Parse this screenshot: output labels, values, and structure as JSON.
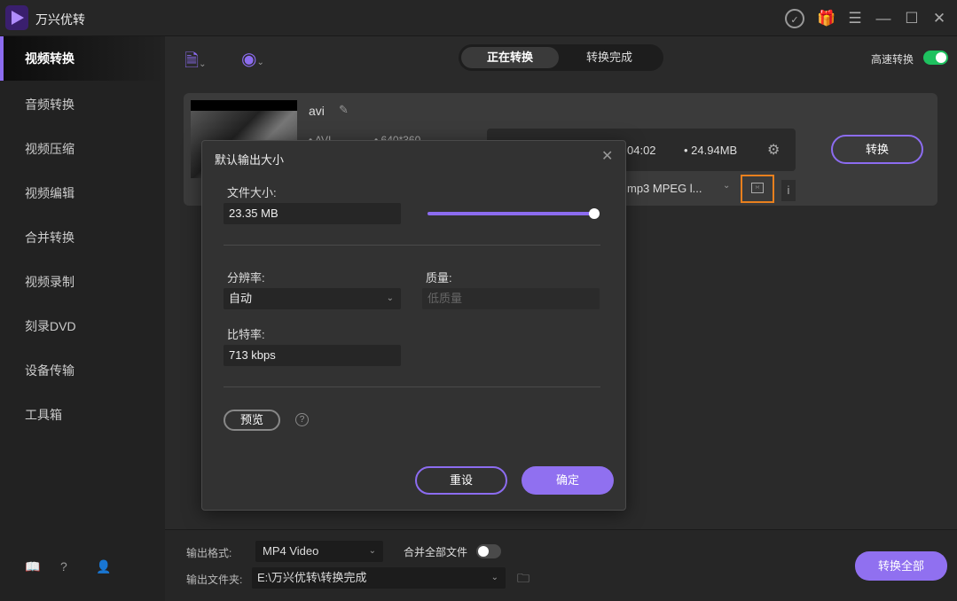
{
  "app": {
    "title": "万兴优转"
  },
  "sidebar": {
    "items": [
      {
        "label": "视频转换"
      },
      {
        "label": "音频转换"
      },
      {
        "label": "视频压缩"
      },
      {
        "label": "视频编辑"
      },
      {
        "label": "合并转换"
      },
      {
        "label": "视频录制"
      },
      {
        "label": "刻录DVD"
      },
      {
        "label": "设备传输"
      },
      {
        "label": "工具箱"
      }
    ]
  },
  "tabs": [
    {
      "label": "正在转换"
    },
    {
      "label": "转换完成"
    }
  ],
  "toolbar": {
    "fast_convert": "高速转换",
    "fast_convert_on": true
  },
  "file": {
    "name": "avi",
    "format": "AVI",
    "resolution": "640*360",
    "duration": "04:02",
    "size": "24.94MB",
    "output_format": "mp3 MPEG l...",
    "convert": "转换"
  },
  "dialog": {
    "title": "默认输出大小",
    "file_size_label": "文件大小:",
    "file_size": "23.35 MB",
    "slider_percent": 100,
    "resolution_label": "分辨率:",
    "resolution": "自动",
    "quality_label": "质量:",
    "quality_placeholder": "低质量",
    "bitrate_label": "比特率:",
    "bitrate": "713 kbps",
    "preview": "预览",
    "reset": "重设",
    "ok": "确定"
  },
  "bottom": {
    "format_label": "输出格式:",
    "format": "MP4 Video",
    "merge_label": "合并全部文件",
    "merge_on": false,
    "folder_label": "输出文件夹:",
    "folder": "E:\\万兴优转\\转换完成",
    "convert_all": "转换全部"
  },
  "colors": {
    "accent": "#8c6cf0",
    "toggle_on": "#1ec15f",
    "highlight": "#e8801e"
  }
}
